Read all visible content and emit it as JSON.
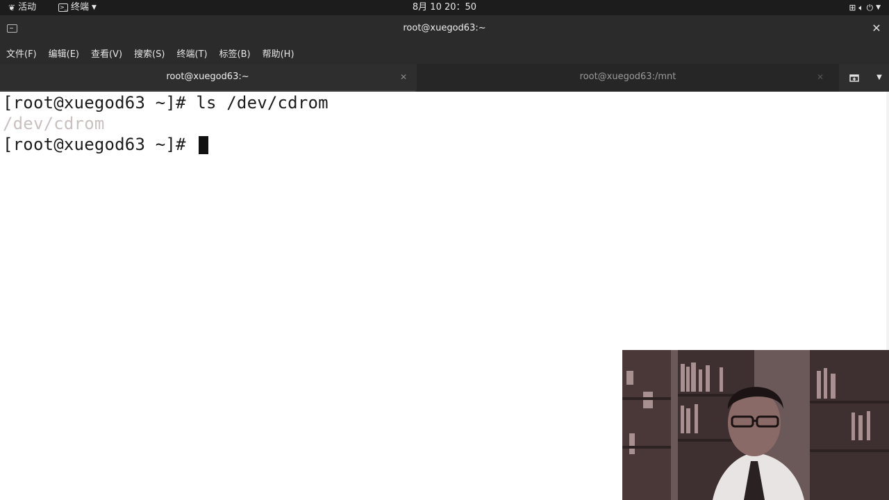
{
  "topbar": {
    "activities_label": "活动",
    "app_menu_label": "终端",
    "clock": "8月 10  20：50",
    "icons": [
      "network-icon",
      "volume-icon",
      "power-icon"
    ]
  },
  "window": {
    "title": "root@xuegod63:~"
  },
  "menubar": {
    "items": [
      "文件(F)",
      "编辑(E)",
      "查看(V)",
      "搜索(S)",
      "终端(T)",
      "标签(B)",
      "帮助(H)"
    ]
  },
  "tabs": [
    {
      "label": "root@xuegod63:~",
      "active": true
    },
    {
      "label": "root@xuegod63:/mnt",
      "active": false
    }
  ],
  "terminal": {
    "line1": "[root@xuegod63 ~]# ls /dev/cdrom",
    "line2": "/dev/cdrom",
    "line3_prompt": "[root@xuegod63 ~]# "
  },
  "colors": {
    "topbar_bg": "#1c1c1c",
    "chrome_bg": "#2b2b2b",
    "terminal_bg": "#ffffff",
    "terminal_fg": "#1a1a1a",
    "symlink_fg": "#c9c0c0"
  }
}
